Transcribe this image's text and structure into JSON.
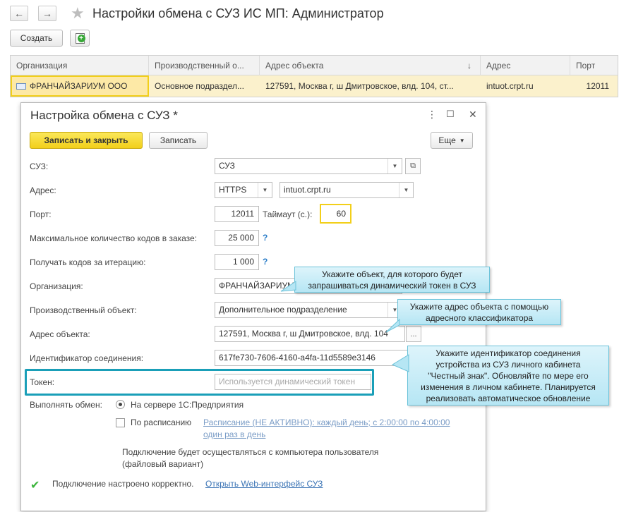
{
  "window": {
    "title": "Настройки обмена с СУЗ ИС МП: Администратор",
    "back_icon": "←",
    "forward_icon": "→",
    "star_icon": "★"
  },
  "toolbar": {
    "create_label": "Создать",
    "copy_icon": "+"
  },
  "table": {
    "columns": [
      "Организация",
      "Производственный о...",
      "Адрес объекта",
      "Адрес",
      "Порт"
    ],
    "sort_icon": "↓",
    "row": {
      "org": "ФРАНЧАЙЗАРИУМ ООО",
      "object": "Основное подраздел...",
      "object_address": "127591, Москва г, ш Дмитровское, влд. 104, ст...",
      "address": "intuot.crpt.ru",
      "port": "12011"
    }
  },
  "dialog": {
    "title": "Настройка обмена с СУЗ *",
    "menu_icon": "⋮",
    "maximize_icon": "☐",
    "close_icon": "✕",
    "save_close_label": "Записать и закрыть",
    "save_label": "Записать",
    "more_label": "Еще",
    "fields": {
      "suz_label": "СУЗ:",
      "suz_value": "СУЗ",
      "address_label": "Адрес:",
      "protocol_value": "HTTPS",
      "host_value": "intuot.crpt.ru",
      "port_label": "Порт:",
      "port_value": "12011",
      "timeout_label": "Таймаут (с.):",
      "timeout_value": "60",
      "max_codes_label": "Максимальное количество кодов в заказе:",
      "max_codes_value": "25 000",
      "per_iteration_label": "Получать кодов за итерацию:",
      "per_iteration_value": "1 000",
      "org_label": "Организация:",
      "org_value": "ФРАНЧАЙЗАРИУМ ООО",
      "object_label": "Производственный объект:",
      "object_value": "Дополнительное подразделение",
      "object_address_label": "Адрес объекта:",
      "object_address_value": "127591, Москва г, ш Дмитровское, влд. 104",
      "conn_id_label": "Идентификатор соединения:",
      "conn_id_value": "617fe730-7606-4160-a4fa-11d5589e3146",
      "token_label": "Токен:",
      "token_placeholder": "Используется динамический токен",
      "help_mark": "?",
      "ellipsis": "..."
    },
    "exchange": {
      "label": "Выполнять обмен:",
      "server_option": "На сервере 1С:Предприятия",
      "schedule_option": "По расписанию",
      "schedule_link_1": "Расписание (НЕ АКТИВНО): каждый день; с 2:00:00 по 4:00:00",
      "schedule_link_2": "один раз в день",
      "note_1": "Подключение будет осуществляться с компьютера пользователя",
      "note_2": "(файловый вариант)"
    },
    "status": {
      "ok_icon": "✔",
      "text": "Подключение настроено корректно.",
      "link": "Открыть Web-интерфейс СУЗ"
    }
  },
  "callouts": {
    "c1_line1": "Укажите объект, для которого будет",
    "c1_line2": "запрашиваться динамический токен в СУЗ",
    "c2_line1": "Укажите адрес объекта с помощью",
    "c2_line2": "адресного классификатора",
    "c3_line1": "Укажите идентификатор соединения",
    "c3_line2": "устройства из СУЗ личного кабинета",
    "c3_line3": "\"Честный знак\". Обновляйте по мере его",
    "c3_line4": "изменения в личном кабинете. Планируется",
    "c3_line5": "реализовать автоматическое обновление"
  },
  "colors": {
    "accent_yellow": "#f2cf1a",
    "selection_row": "#fbf1cc",
    "highlight_border": "#1a9fb8",
    "callout_bg": "#c9eef8",
    "link": "#3b74b5",
    "ok_green": "#3db53d"
  }
}
